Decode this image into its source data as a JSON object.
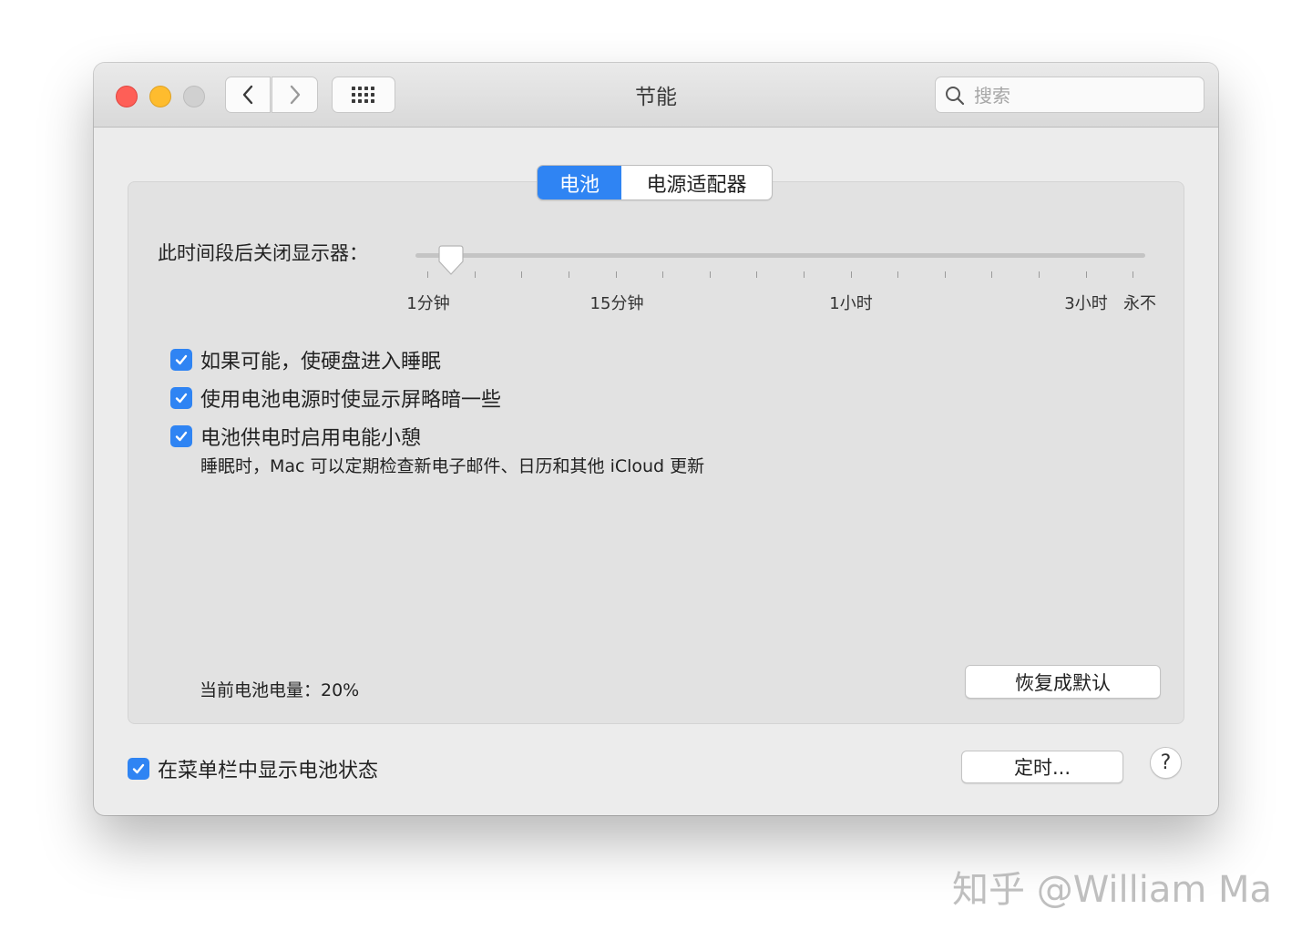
{
  "window": {
    "title": "节能",
    "search_placeholder": "搜索"
  },
  "tabs": {
    "battery": "电池",
    "power_adapter": "电源适配器",
    "selected": "电池"
  },
  "slider": {
    "label": "此时间段后关闭显示器：",
    "ticks": [
      "1分钟",
      "15分钟",
      "1小时",
      "3小时",
      "永不"
    ],
    "value": "1分钟"
  },
  "options": [
    {
      "label": "如果可能，使硬盘进入睡眠",
      "checked": true
    },
    {
      "label": "使用电池电源时使显示屏略暗一些",
      "checked": true
    },
    {
      "label": "电池供电时启用电能小憩",
      "checked": true
    }
  ],
  "power_nap_note": "睡眠时，Mac 可以定期检查新电子邮件、日历和其他 iCloud 更新",
  "battery_level": "当前电池电量：20%",
  "restore_button": "恢复成默认",
  "menu_bar_option": {
    "label": "在菜单栏中显示电池状态",
    "checked": true
  },
  "schedule_button": "定时...",
  "help_button": "?",
  "watermark": "知乎 @William Ma",
  "colors": {
    "accent": "#2f84f3",
    "close": "#fe5f57",
    "minimize": "#febc2e",
    "zoom_disabled": "#d0d0d0"
  }
}
